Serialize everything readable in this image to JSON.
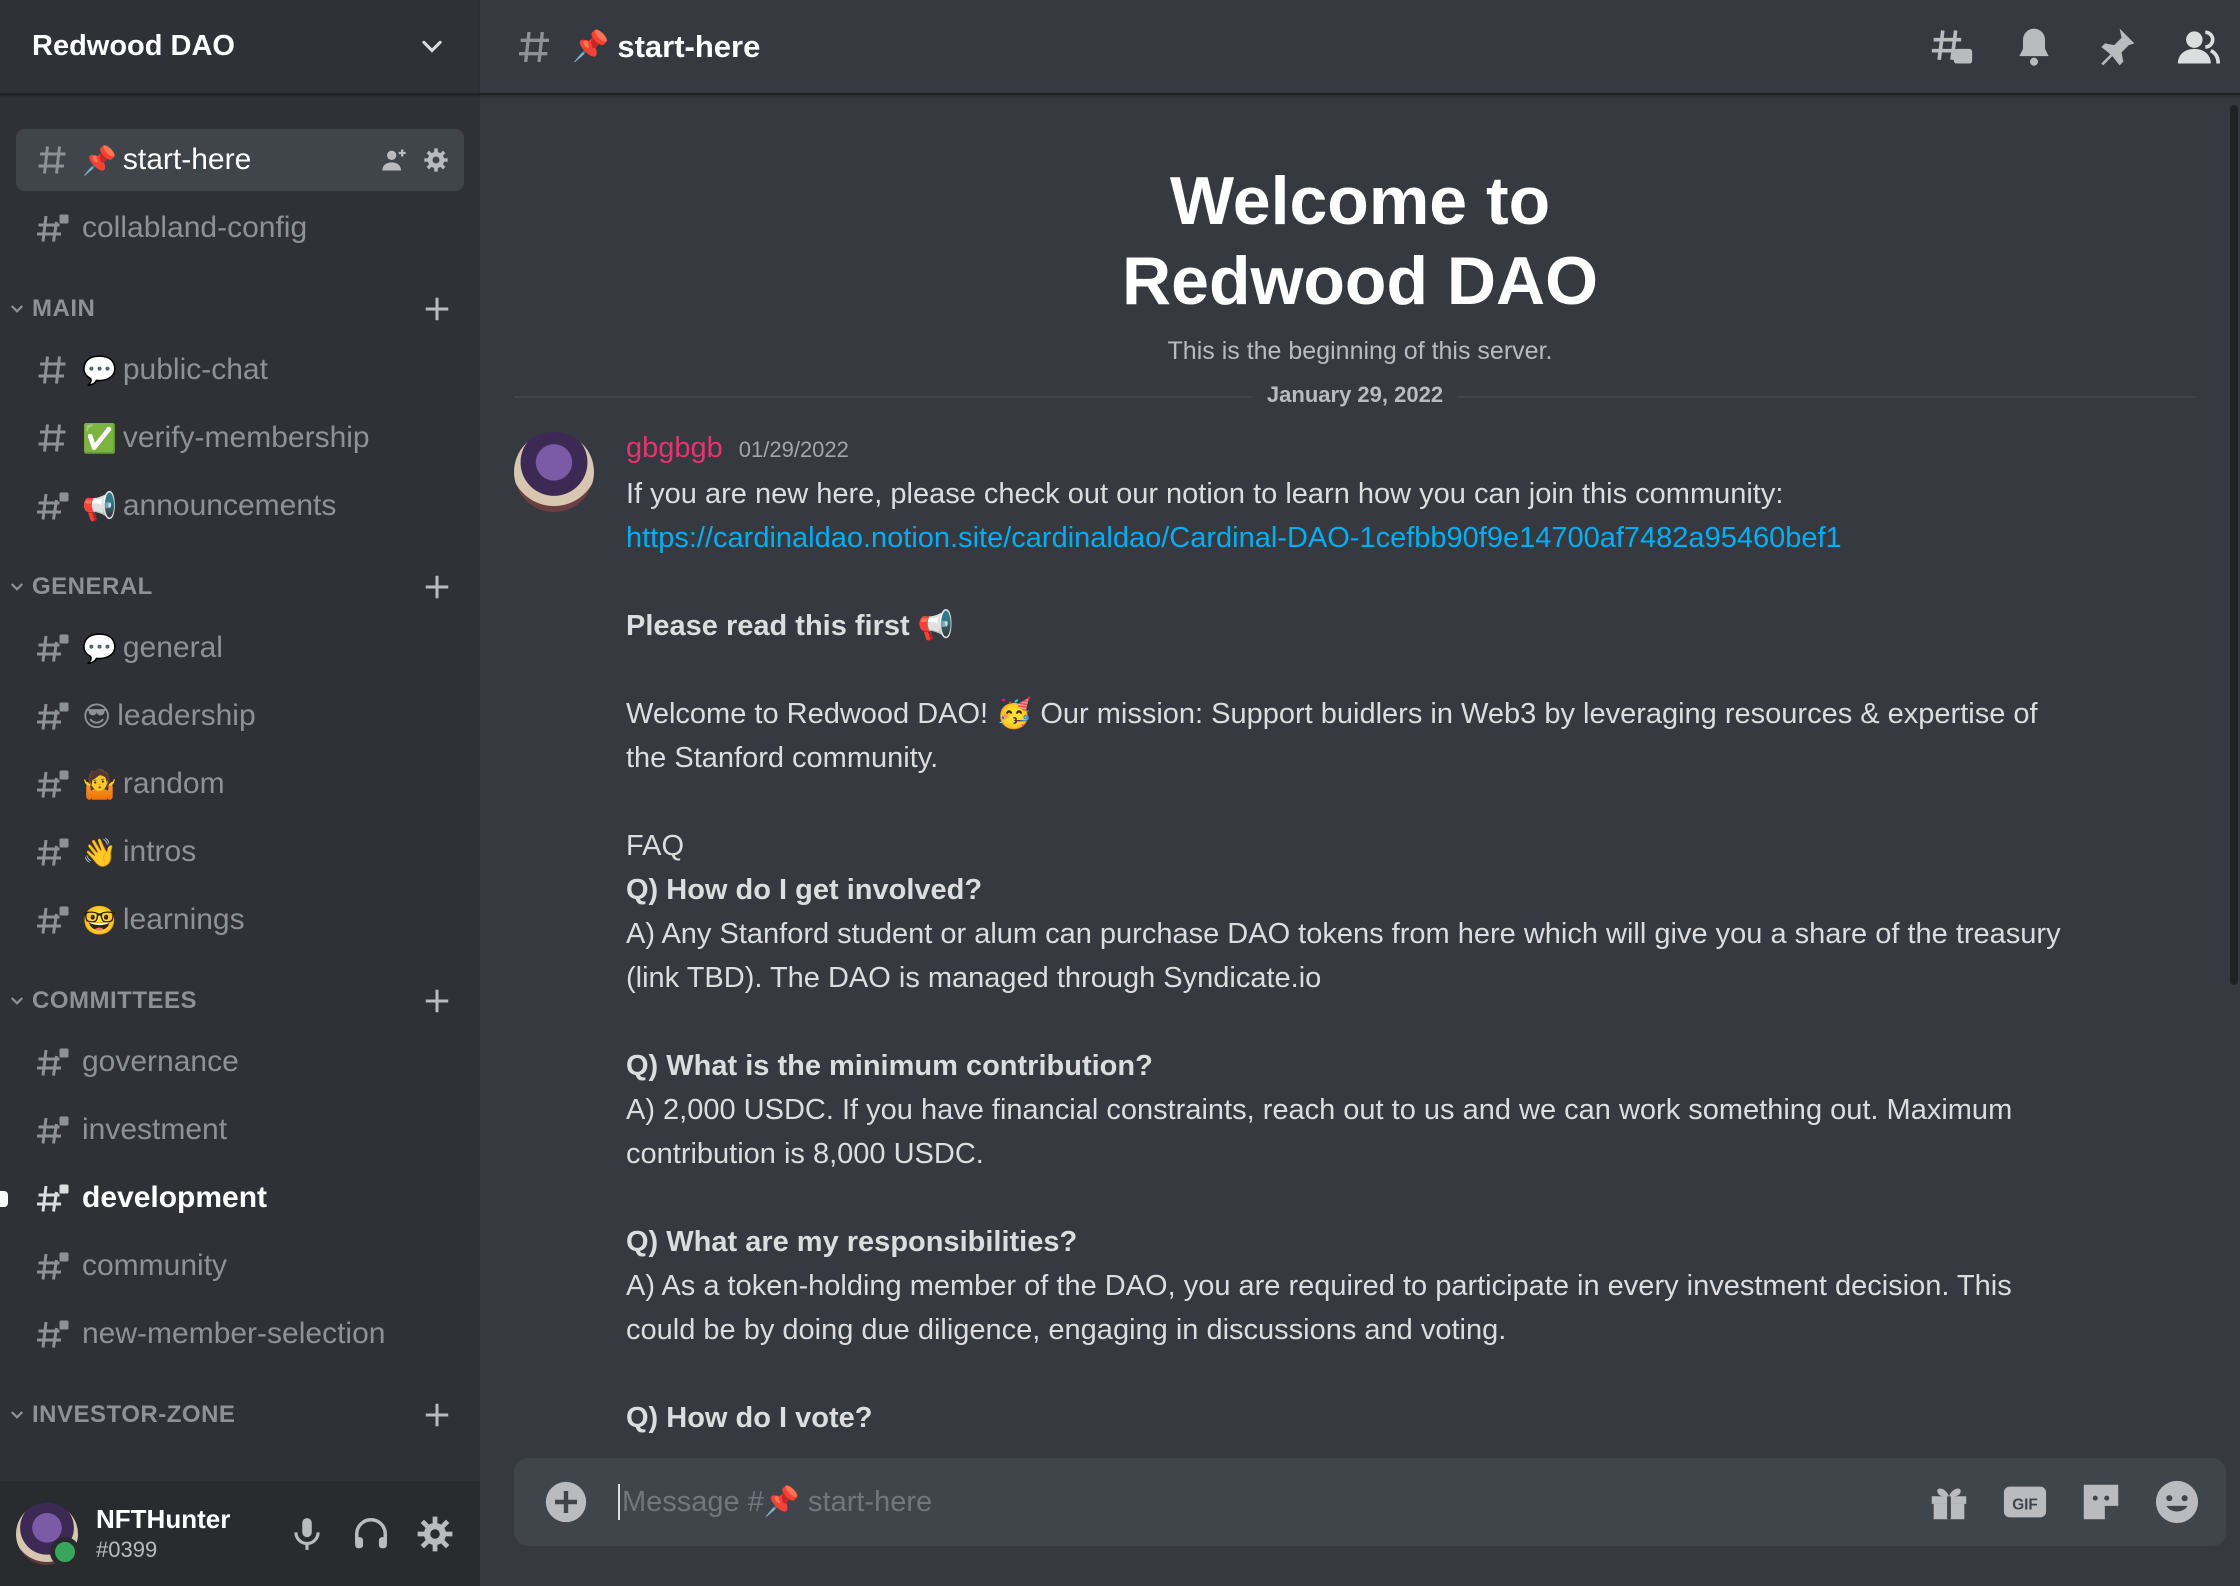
{
  "server": {
    "name": "Redwood DAO"
  },
  "sidebar": {
    "top_channels": [
      {
        "emoji": "📌",
        "name": "start-here",
        "selected": true
      },
      {
        "emoji": "",
        "name": "collabland-config"
      }
    ],
    "categories": [
      {
        "name": "MAIN",
        "channels": [
          {
            "emoji": "💬",
            "name": "public-chat"
          },
          {
            "emoji": "✅",
            "name": "verify-membership"
          },
          {
            "emoji": "📢",
            "name": "announcements"
          }
        ]
      },
      {
        "name": "GENERAL",
        "channels": [
          {
            "emoji": "💬",
            "name": "general"
          },
          {
            "emoji": "😎",
            "name": "leadership"
          },
          {
            "emoji": "🤷",
            "name": "random"
          },
          {
            "emoji": "👋",
            "name": "intros"
          },
          {
            "emoji": "🤓",
            "name": "learnings"
          }
        ]
      },
      {
        "name": "COMMITTEES",
        "channels": [
          {
            "emoji": "",
            "name": "governance"
          },
          {
            "emoji": "",
            "name": "investment"
          },
          {
            "emoji": "",
            "name": "development",
            "unread": true
          },
          {
            "emoji": "",
            "name": "community"
          },
          {
            "emoji": "",
            "name": "new-member-selection"
          }
        ]
      },
      {
        "name": "INVESTOR-ZONE",
        "channels": []
      }
    ]
  },
  "user": {
    "name": "NFTHunter",
    "discriminator": "#0399"
  },
  "channel_header": {
    "emoji": "📌",
    "title": "start-here"
  },
  "welcome": {
    "title": "Welcome to Redwood DAO",
    "subtitle": "This is the beginning of this server."
  },
  "date_divider": "January 29, 2022",
  "message": {
    "author": "gbgbgb",
    "timestamp": "01/29/2022",
    "intro": "If you are new here, please check out our notion to learn how you can join this community:",
    "link": "https://cardinaldao.notion.site/cardinaldao/Cardinal-DAO-1cefbb90f9e14700af7482a95460bef1",
    "read_first": "Please read this first 📢",
    "welcome_line_1": "Welcome to Redwood DAO! 🥳 Our mission: Support buidlers in Web3 by leveraging resources & expertise of",
    "welcome_line_2": "the Stanford community.",
    "faq": "FAQ",
    "q1": "Q) How do I get involved?",
    "a1_line_1": "A) Any Stanford student or alum can purchase DAO tokens from here which will give you a share of the treasury",
    "a1_line_2": "(link TBD). The DAO is managed through Syndicate.io",
    "q2": "Q) What is the minimum contribution?",
    "a2_line_1": "A) 2,000 USDC. If you have financial constraints, reach out to us and we can work something out. Maximum",
    "a2_line_2": "contribution is 8,000 USDC.",
    "q3": "Q) What are my responsibilities?",
    "a3_line_1": "A) As a token-holding member of the DAO, you are required to participate in every investment decision. This",
    "a3_line_2": "could be by doing due diligence, engaging in discussions and voting.",
    "q4": "Q) How do I vote?"
  },
  "composer": {
    "placeholder": "Message #📌 start-here"
  },
  "icons": {
    "header": [
      "threads-icon",
      "bell-icon",
      "pin-icon",
      "members-icon"
    ],
    "composer": [
      "gift-icon",
      "gif-icon",
      "sticker-icon",
      "emoji-icon"
    ]
  }
}
